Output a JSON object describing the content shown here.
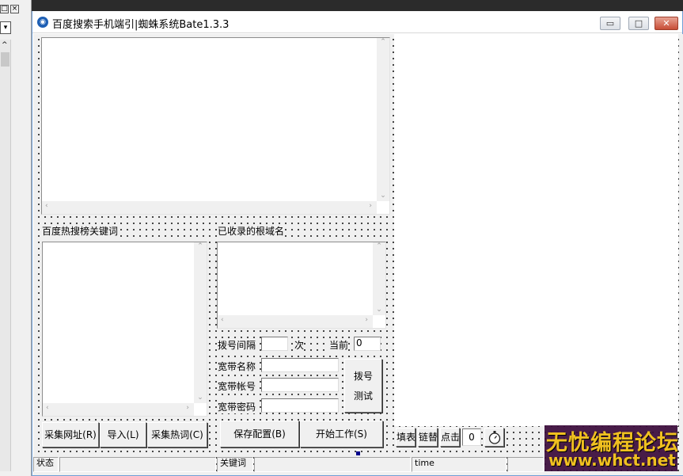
{
  "ide": {
    "close_glyph": "×",
    "restore_glyph": "□",
    "combo_glyph": "▾",
    "scroll_up": "^"
  },
  "window": {
    "title": "百度搜索手机端引|蜘蛛系统Bate1.3.3",
    "icon": "app-globe-icon",
    "minimize": "▭",
    "maximize": "□",
    "close": "✕"
  },
  "left": {
    "hot_keywords_label": "百度热搜榜关键词",
    "domains_label": "已收录的根域名",
    "dial_interval_label": "拨号间隔",
    "dial_interval_value": "",
    "times_label": "次",
    "current_label": "当前",
    "current_value": "0",
    "broadband_name_label": "宽带名称",
    "broadband_account_label": "宽带帐号",
    "broadband_password_label": "宽带密码",
    "broadband_name_value": "",
    "broadband_account_value": "",
    "broadband_password_value": "",
    "dial_test_line1": "拨号",
    "dial_test_line2": "测试"
  },
  "buttons": {
    "collect_url": "采集网址(R)",
    "import": "导入(L)",
    "collect_hot": "采集热词(C)",
    "save_config": "保存配置(B)",
    "start_work": "开始工作(S)"
  },
  "tools": {
    "fill_form": "填表",
    "chain_replace": "链替",
    "click": "点击",
    "counter": "0",
    "timer_icon": "stopwatch-icon"
  },
  "status_bar": {
    "status_label": "状态",
    "status_value": "",
    "keyword_label": "关键词",
    "keyword_value": "",
    "time_label": "time"
  },
  "scroll": {
    "up": "⌃",
    "down": "⌄",
    "left": "‹",
    "right": "›"
  },
  "watermark": {
    "line1": "无忧编程论坛",
    "line2": "www.whct.net"
  },
  "colors": {
    "accent": "#1e5fb4",
    "watermark": "#f0c020",
    "title_border": "#6f9fd6"
  }
}
